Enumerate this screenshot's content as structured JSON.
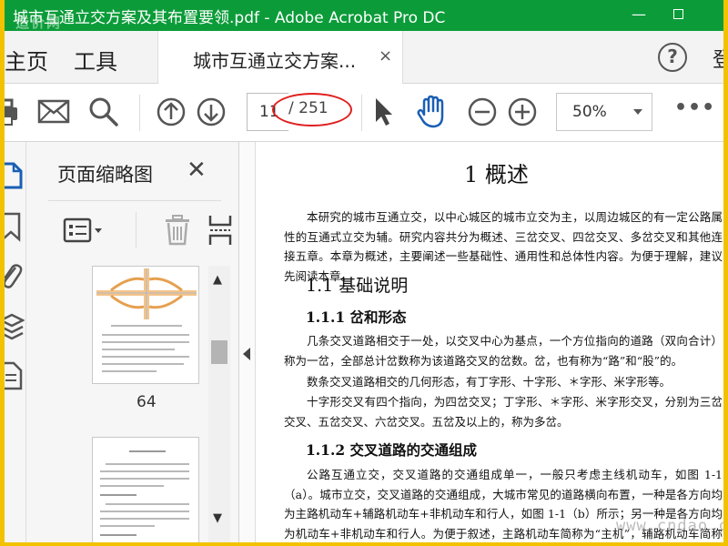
{
  "window": {
    "title": "城市互通立交方案及其布置要领.pdf - Adobe Acrobat Pro DC",
    "watermark": "造价网",
    "minimize_glyph": "—"
  },
  "tabs": {
    "home": "主页",
    "tools": "工具",
    "document_tab": "城市互通立交方案...",
    "close_glyph": "×",
    "help_glyph": "?",
    "login": "登"
  },
  "toolbar": {
    "current_page": "11",
    "total_pages": "/ 251",
    "zoom": "50%",
    "more": "•••"
  },
  "thumbnails": {
    "title": "页面缩略图",
    "close_glyph": "✕",
    "page_label": "64"
  },
  "document": {
    "heading": "1  概述",
    "intro": "本研究的城市互通立交，以中心城区的城市立交为主，以周边城区的有一定公路属性的互通式立交为辅。研究内容共分为概述、三岔交叉、四岔交叉、多岔交叉和其他连接五章。本章为概述，主要阐述一些基础性、通用性和总体性内容。为便于理解，建议先阅读本章。",
    "section_1_1": "1.1  基础说明",
    "section_1_1_1": "1.1.1  岔和形态",
    "para_1": "几条交叉道路相交于一处，以交叉中心为基点，一个方位指向的道路（双向合计）称为一岔，全部总计岔数称为该道路交叉的岔数。岔，也有称为“路”和“股”的。",
    "para_2": "数条交叉道路相交的几何形态，有丁字形、十字形、＊字形、米字形等。",
    "para_3": "十字形交叉有四个指向，为四岔交叉；丁字形、＊字形、米字形交叉，分别为三岔交叉、五岔交叉、六岔交叉。五岔及以上的，称为多岔。",
    "section_1_1_2": "1.1.2  交叉道路的交通组成",
    "para_4": "公路互通立交，交叉道路的交通组成单一，一般只考虑主线机动车，如图 1-1（a）。城市立交，交叉道路的交通组成，大城市常见的道路横向布置，一种是各方向均为主路机动车+辅路机动车+非机动车和行人，如图 1-1（b）所示；另一种是各方向均为机动车+非机动车和行人。为便于叙述，主路机动车简称为“主机”，辅路机动车简称为“辅机”，非机动车简",
    "watermark": "www.cndao.com"
  },
  "colors": {
    "title_bar": "#0b9c39",
    "annotation_ellipse": "#e02020",
    "frame_border": "#f2c200"
  },
  "icons": {
    "toolbar": [
      "print-icon",
      "mail-icon",
      "search-icon",
      "page-up-icon",
      "page-down-icon",
      "select-arrow-icon",
      "hand-icon",
      "zoom-out-icon",
      "zoom-in-icon"
    ],
    "rail": [
      "page-thumbnails-icon",
      "bookmark-icon",
      "attachment-icon",
      "layers-icon",
      "document-icon"
    ],
    "thumbnail_tools": [
      "options-icon",
      "delete-icon",
      "extract-icon"
    ]
  }
}
